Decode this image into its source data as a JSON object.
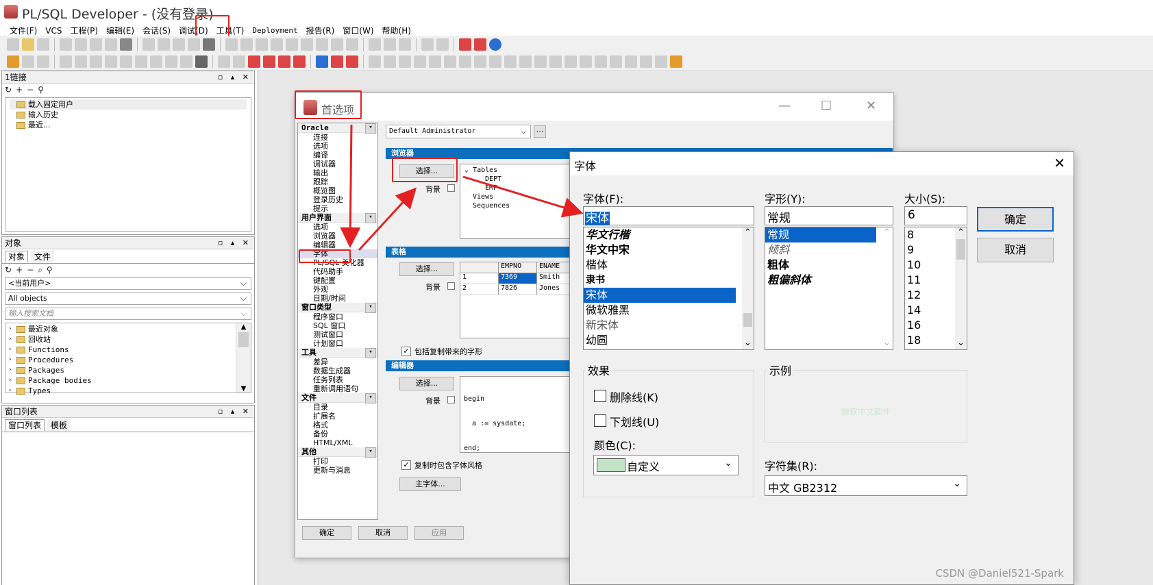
{
  "app": {
    "title": "PL/SQL Developer - (没有登录)"
  },
  "menu": [
    "文件(F)",
    "VCS",
    "工程(P)",
    "编辑(E)",
    "会话(S)",
    "调试(D)",
    "工具(T)",
    "Deployment",
    "报告(R)",
    "窗口(W)",
    "帮助(H)"
  ],
  "connections_panel": {
    "title": "1链接",
    "items": [
      "载入固定用户",
      "输入历史",
      "最近..."
    ]
  },
  "objects_panel": {
    "title": "对象",
    "tabs": [
      "对象",
      "文件"
    ],
    "user_select": "<当前用户>",
    "filter_select": "All objects",
    "search_placeholder": "输入搜索文档",
    "tree": [
      "最近对象",
      "回收站",
      "Functions",
      "Procedures",
      "Packages",
      "Package bodies",
      "Types"
    ]
  },
  "windows_panel": {
    "title": "窗口列表",
    "tabs": [
      "窗口列表",
      "模板"
    ]
  },
  "prefs": {
    "title": "首选项",
    "profile": "Default Administrator",
    "groups": [
      {
        "header": "Oracle",
        "items": [
          "连接",
          "选项",
          "编译",
          "调试器",
          "输出",
          "跟踪",
          "概览图",
          "登录历史",
          "提示"
        ]
      },
      {
        "header": "用户界面",
        "items": [
          "选项",
          "浏览器",
          "编辑器",
          "字体",
          "PL/SQL 美化器",
          "代码助手",
          "键配置",
          "外观",
          "日期/时间"
        ]
      },
      {
        "header": "窗口类型",
        "items": [
          "程序窗口",
          "SQL 窗口",
          "测试窗口",
          "计划窗口"
        ]
      },
      {
        "header": "工具",
        "items": [
          "差异",
          "数据生成器",
          "任务列表",
          "重新调用语句"
        ]
      },
      {
        "header": "文件",
        "items": [
          "目录",
          "扩展名",
          "格式",
          "备份",
          "HTML/XML"
        ]
      },
      {
        "header": "其他",
        "items": [
          "打印",
          "更新与消息"
        ]
      }
    ],
    "sections": {
      "browser": "浏览器",
      "grid": "表格",
      "editor": "编辑器"
    },
    "select_label": "选择...",
    "background_label": "背景",
    "browser_preview": [
      "Tables",
      "DEPT",
      "EMP",
      "Views",
      "Sequences"
    ],
    "grid_preview": {
      "headers": [
        "EMPNO",
        "ENAME"
      ],
      "rows": [
        [
          "1",
          "7369",
          "Smith"
        ],
        [
          "2",
          "7826",
          "Jones"
        ]
      ]
    },
    "editor_preview": [
      "begin",
      "  a := sysdate;",
      "end;"
    ],
    "include_copy_label": "包括复制带来的字形",
    "copy_style_label": "复制时包含字体风格",
    "main_font_label": "主字体...",
    "buttons": {
      "ok": "确定",
      "cancel": "取消",
      "apply": "应用"
    }
  },
  "font_dialog": {
    "title": "字体",
    "font_label": "字体(F):",
    "font_value": "宋体",
    "fonts": [
      "华文行楷",
      "华文中宋",
      "楷体",
      "隶书",
      "宋体",
      "微软雅黑",
      "新宋体",
      "幼圆"
    ],
    "style_label": "字形(Y):",
    "style_value": "常规",
    "styles": [
      "常规",
      "倾斜",
      "粗体",
      "粗偏斜体"
    ],
    "size_label": "大小(S):",
    "size_value": "6",
    "sizes": [
      "8",
      "9",
      "10",
      "11",
      "12",
      "14",
      "16",
      "18"
    ],
    "ok": "确定",
    "cancel": "取消",
    "effects_label": "效果",
    "strike_label": "删除线(K)",
    "underline_label": "下划线(U)",
    "color_label": "颜色(C):",
    "color_value": "自定义",
    "color_swatch": "#c3e4c8",
    "sample_label": "示例",
    "sample_text": "微软中文软件",
    "charset_label": "字符集(R):",
    "charset_value": "中文 GB2312"
  },
  "watermark": "CSDN @Daniel521-Spark"
}
